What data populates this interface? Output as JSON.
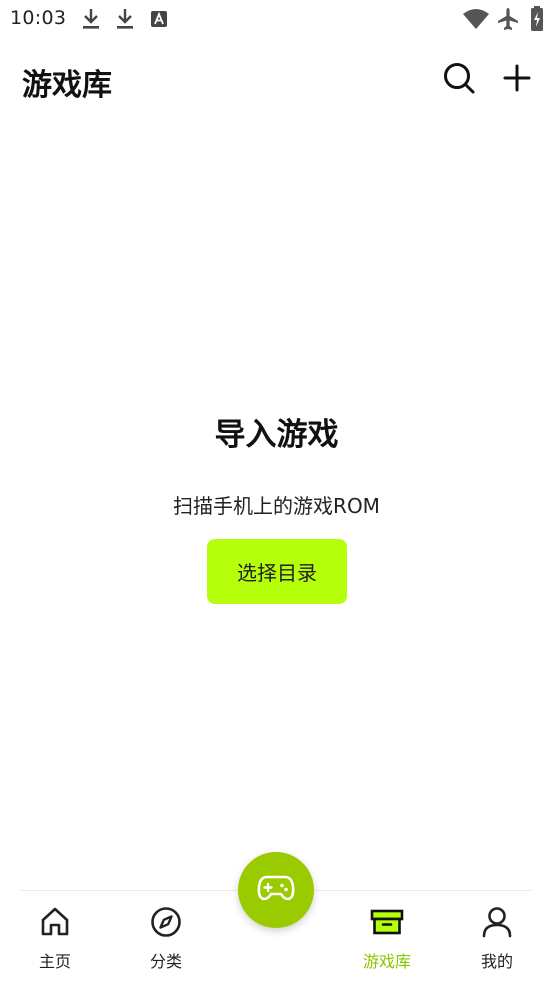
{
  "status_bar": {
    "time": "10:03",
    "icons": [
      "download-icon",
      "download-icon",
      "text-a-icon",
      "wifi-icon",
      "airplane-icon",
      "battery-charging-icon"
    ]
  },
  "header": {
    "title": "游戏库",
    "actions": [
      "search-icon",
      "plus-icon"
    ]
  },
  "empty_state": {
    "title": "导入游戏",
    "subtitle": "扫描手机上的游戏ROM",
    "button_label": "选择目录"
  },
  "bottom_nav": {
    "items": [
      {
        "label": "主页",
        "icon": "home-icon",
        "active": false
      },
      {
        "label": "分类",
        "icon": "compass-icon",
        "active": false
      },
      {
        "label": "游戏库",
        "icon": "archive-box-icon",
        "active": true
      },
      {
        "label": "我的",
        "icon": "user-icon",
        "active": false
      }
    ],
    "center_button_icon": "gamepad-icon"
  },
  "colors": {
    "accent": "#b6ff0a",
    "fab": "#9acb00",
    "active_label": "#8ac600",
    "text": "#111111"
  }
}
